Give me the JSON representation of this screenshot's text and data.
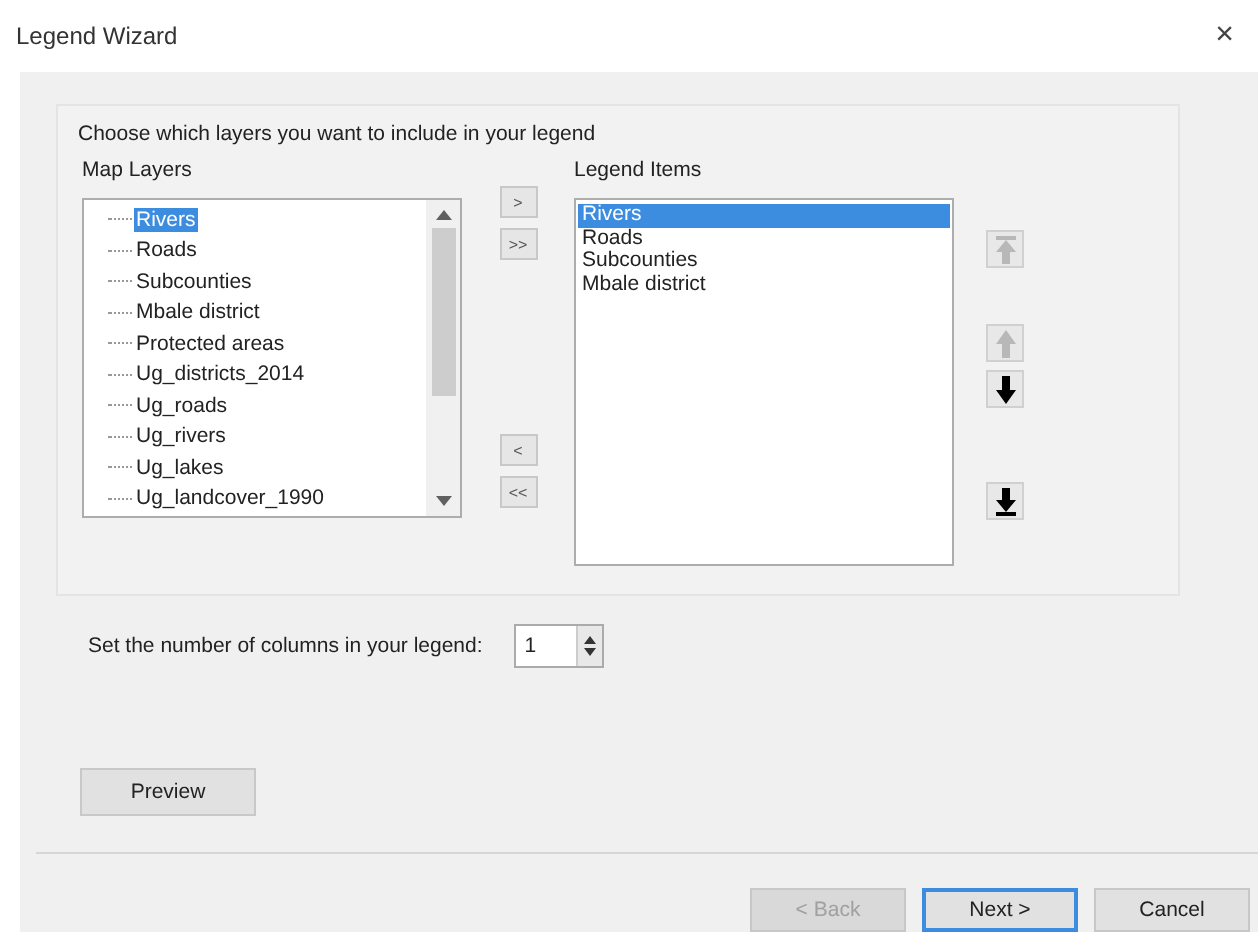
{
  "window": {
    "title": "Legend Wizard",
    "close": "×"
  },
  "instruction": "Choose which layers you want to include in your legend",
  "map_layers": {
    "label": "Map Layers",
    "items": [
      {
        "label": "Rivers",
        "selected": true
      },
      {
        "label": "Roads",
        "selected": false
      },
      {
        "label": "Subcounties",
        "selected": false
      },
      {
        "label": "Mbale district",
        "selected": false
      },
      {
        "label": "Protected areas",
        "selected": false
      },
      {
        "label": "Ug_districts_2014",
        "selected": false
      },
      {
        "label": "Ug_roads",
        "selected": false
      },
      {
        "label": "Ug_rivers",
        "selected": false
      },
      {
        "label": "Ug_lakes",
        "selected": false
      },
      {
        "label": "Ug_landcover_1990",
        "selected": false
      }
    ]
  },
  "transfer_buttons": [
    ">",
    ">>",
    "<",
    "<<"
  ],
  "legend_items": {
    "label": "Legend Items",
    "items": [
      {
        "label": "Rivers",
        "selected": true
      },
      {
        "label": "Roads",
        "selected": false
      },
      {
        "label": "Subcounties",
        "selected": false
      },
      {
        "label": "Mbale district",
        "selected": false
      }
    ]
  },
  "order_buttons": [
    {
      "kind": "top",
      "disabled": true
    },
    {
      "kind": "up",
      "disabled": true
    },
    {
      "kind": "down",
      "disabled": false
    },
    {
      "kind": "bottom",
      "disabled": false
    }
  ],
  "columns": {
    "label": "Set the number of columns in your legend:",
    "value": "1"
  },
  "preview_button": "Preview",
  "footer_buttons": [
    {
      "label": "< Back",
      "disabled": true,
      "default": false
    },
    {
      "label": "Next >",
      "disabled": false,
      "default": true
    },
    {
      "label": "Cancel",
      "disabled": false,
      "default": false
    }
  ]
}
